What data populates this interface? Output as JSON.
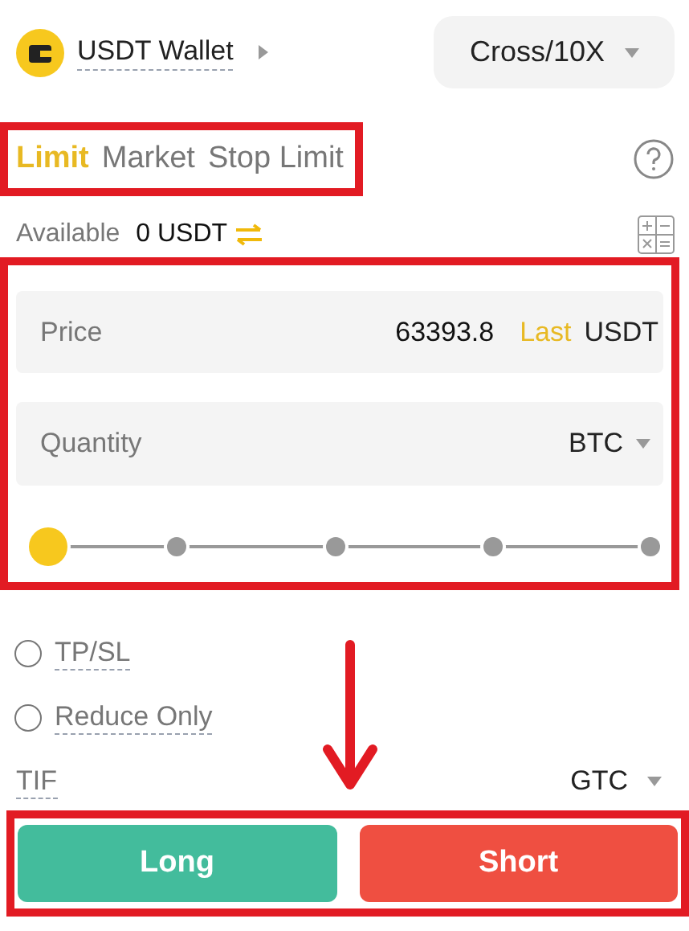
{
  "wallet": {
    "label": "USDT Wallet"
  },
  "margin_mode": {
    "label": "Cross/10X"
  },
  "order_tabs": [
    {
      "label": "Limit",
      "selected": true
    },
    {
      "label": "Market",
      "selected": false
    },
    {
      "label": "Stop Limit",
      "selected": false
    }
  ],
  "available": {
    "label": "Available",
    "value": "0 USDT"
  },
  "price": {
    "label": "Price",
    "value": "63393.8",
    "last": "Last",
    "unit": "USDT"
  },
  "quantity": {
    "label": "Quantity",
    "unit": "BTC"
  },
  "slider": {
    "level": 0
  },
  "options": [
    {
      "label": "TP/SL",
      "checked": false
    },
    {
      "label": "Reduce Only",
      "checked": false
    }
  ],
  "tif": {
    "label": "TIF",
    "value": "GTC"
  },
  "buttons": [
    {
      "label": "Long",
      "kind": "buy"
    },
    {
      "label": "Short",
      "kind": "sell"
    }
  ]
}
